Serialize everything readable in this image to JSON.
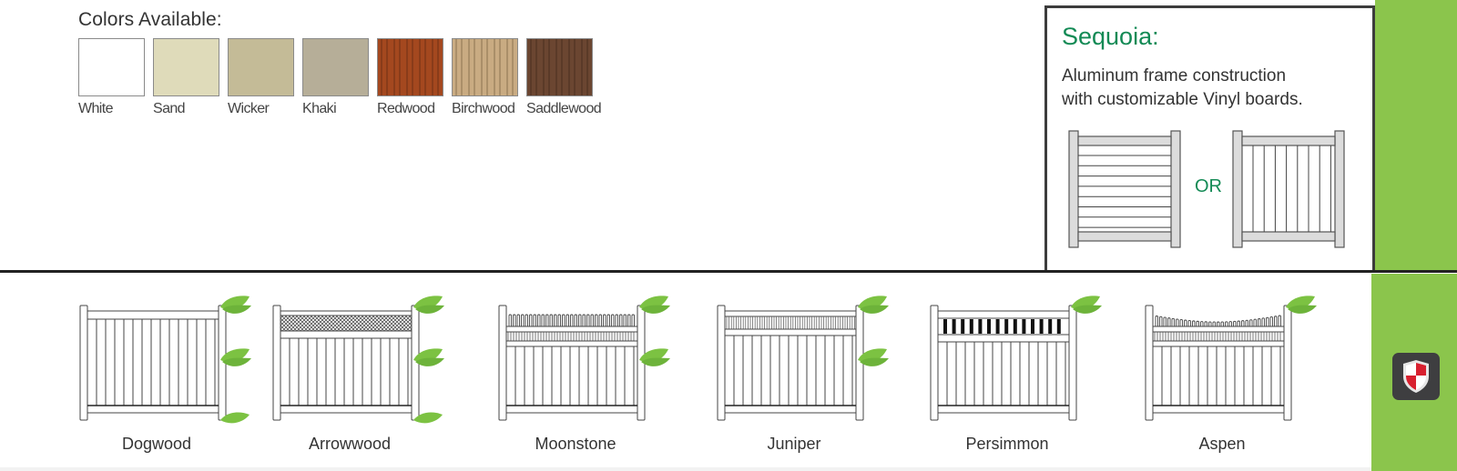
{
  "colors": {
    "title": "Colors Available:",
    "items": [
      {
        "name": "White",
        "hex": "#ffffff",
        "texture": "solid"
      },
      {
        "name": "Sand",
        "hex": "#dfdbba",
        "texture": "solid"
      },
      {
        "name": "Wicker",
        "hex": "#c4bb97",
        "texture": "solid"
      },
      {
        "name": "Khaki",
        "hex": "#b6ae98",
        "texture": "solid"
      },
      {
        "name": "Redwood",
        "hex": "#a4481f",
        "texture": "wood",
        "grain": "#6e2f14"
      },
      {
        "name": "Birchwood",
        "hex": "#c9ab82",
        "texture": "wood",
        "grain": "#8a7350"
      },
      {
        "name": "Saddlewood",
        "hex": "#6b4631",
        "texture": "wood",
        "grain": "#4a2f1f"
      }
    ]
  },
  "sequoia": {
    "title": "Sequoia:",
    "description_line1": "Aluminum frame construction",
    "description_line2": "with customizable Vinyl boards.",
    "or_label": "OR",
    "options": [
      "horizontal-boards",
      "vertical-boards"
    ]
  },
  "fences": [
    {
      "name": "Dogwood",
      "style": "privacy",
      "leaves": 3
    },
    {
      "name": "Arrowwood",
      "style": "lattice",
      "leaves": 3
    },
    {
      "name": "Moonstone",
      "style": "picket-top",
      "leaves": 2
    },
    {
      "name": "Juniper",
      "style": "spindle-top",
      "leaves": 2
    },
    {
      "name": "Persimmon",
      "style": "baluster-top",
      "leaves": 1
    },
    {
      "name": "Aspen",
      "style": "scalloped-picket-top",
      "leaves": 1
    }
  ],
  "theme": {
    "accent_green": "#8bc54c",
    "leaf_green": "#7cc242",
    "title_green": "#138a55",
    "shield_red": "#d8202f"
  },
  "shield_icon": "shield-badge-icon"
}
